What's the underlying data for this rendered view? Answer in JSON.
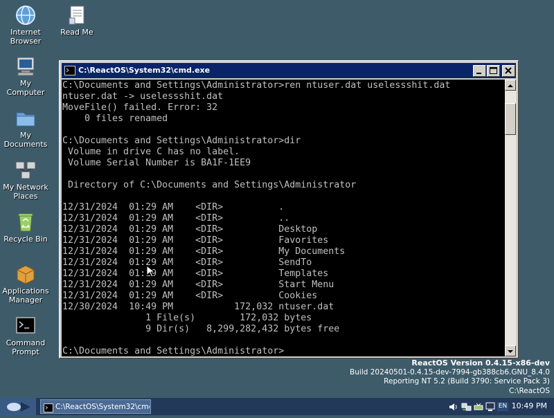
{
  "desktop": {
    "icons": [
      {
        "label": "Internet\nBrowser",
        "icon": "globe-icon"
      },
      {
        "label": "Read Me",
        "icon": "document-icon"
      },
      {
        "label": "My\nComputer",
        "icon": "computer-icon"
      },
      {
        "label": "My\nDocuments",
        "icon": "folder-icon"
      },
      {
        "label": "My Network\nPlaces",
        "icon": "network-icon"
      },
      {
        "label": "Recycle Bin",
        "icon": "recycle-bin-icon"
      },
      {
        "label": "Applications\nManager",
        "icon": "package-icon"
      },
      {
        "label": "Command\nPrompt",
        "icon": "terminal-icon"
      }
    ]
  },
  "window": {
    "title": "C:\\ReactOS\\System32\\cmd.exe",
    "console_text": "C:\\Documents and Settings\\Administrator>ren ntuser.dat uselessshit.dat\nntuser.dat -> uselessshit.dat\nMoveFile() failed. Error: 32\n    0 files renamed\n\nC:\\Documents and Settings\\Administrator>dir\n Volume in drive C has no label.\n Volume Serial Number is BA1F-1EE9\n\n Directory of C:\\Documents and Settings\\Administrator\n\n12/31/2024  01:29 AM    <DIR>          .\n12/31/2024  01:29 AM    <DIR>          ..\n12/31/2024  01:29 AM    <DIR>          Desktop\n12/31/2024  01:29 AM    <DIR>          Favorites\n12/31/2024  01:29 AM    <DIR>          My Documents\n12/31/2024  01:29 AM    <DIR>          SendTo\n12/31/2024  01:29 AM    <DIR>          Templates\n12/31/2024  01:29 AM    <DIR>          Start Menu\n12/31/2024  01:29 AM    <DIR>          Cookies\n12/30/2024  10:49 PM           172,032 ntuser.dat\n               1 File(s)        172,032 bytes\n               9 Dir(s)   8,299,282,432 bytes free\n\nC:\\Documents and Settings\\Administrator>"
  },
  "version_info": {
    "line1": "ReactOS Version 0.4.15-x86-dev",
    "line2": "Build 20240501-0.4.15-dev-7994-gb388cb6.GNU_8.4.0",
    "line3": "Reporting NT 5.2 (Build 3790: Service Pack 3)",
    "line4": "C:\\ReactOS"
  },
  "taskbar": {
    "task_label": "C:\\ReactOS\\System32\\cmd...",
    "language": "EN",
    "clock": "10:49 PM"
  }
}
